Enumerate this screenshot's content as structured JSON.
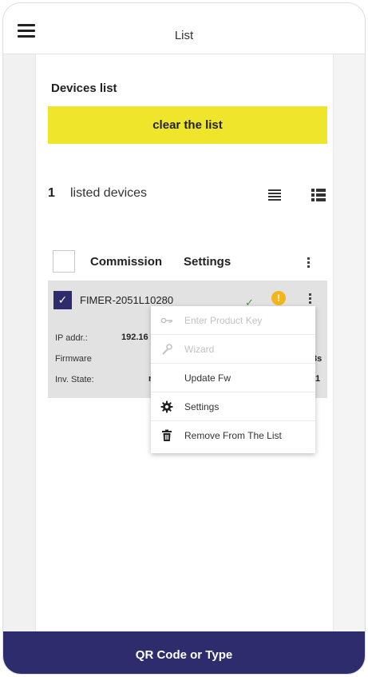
{
  "appbar": {
    "title": "List",
    "menu_icon": "hamburger-icon"
  },
  "devices_section": {
    "title": "Devices list",
    "clear_button": "clear the list",
    "count": "1",
    "count_label": "listed devices",
    "view_icons": [
      "list-view-icon",
      "detail-view-icon"
    ]
  },
  "table_header": {
    "commission": "Commission",
    "settings": "Settings"
  },
  "device": {
    "name": "FIMER-2051L10280",
    "checked": true,
    "ip_label": "IP addr.:",
    "ip_value": "192.16",
    "firmware_label": "Firmware",
    "firmware_value": "3s",
    "inv_state_label": "Inv. State:",
    "inv_state_value": "r",
    "inv_state_value_right": "1",
    "status_icons": [
      "check-icon",
      "warning-icon"
    ]
  },
  "context_menu": {
    "items": [
      {
        "label": "Enter Product Key",
        "icon": "key-icon",
        "enabled": false
      },
      {
        "label": "Wizard",
        "icon": "wrench-icon",
        "enabled": false
      },
      {
        "label": "Update Fw",
        "icon": "",
        "enabled": true
      },
      {
        "label": "Settings",
        "icon": "gear-icon",
        "enabled": true
      },
      {
        "label": "Remove From The List",
        "icon": "trash-icon",
        "enabled": true
      }
    ]
  },
  "bottom_bar": {
    "label": "QR Code or Type"
  },
  "colors": {
    "accent_yellow": "#efe52b",
    "brand_navy": "#2f2c6e",
    "warning": "#f2b61b",
    "ok_green": "#3d9a3d"
  }
}
